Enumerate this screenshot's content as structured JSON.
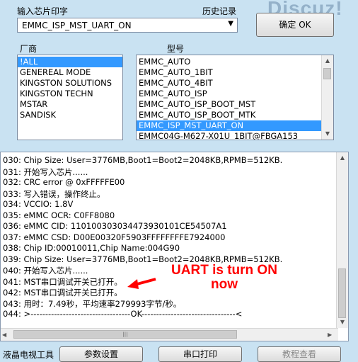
{
  "header": {
    "chip_label": "输入芯片印字",
    "history_label": "历史记录",
    "chip_value": "EMMC_ISP_MST_UART_ON",
    "confirm_button": "确定 OK"
  },
  "watermark": "Discuz!",
  "vendor": {
    "label": "厂商",
    "items": [
      "!ALL",
      "GENEREAL MODE",
      "KINGSTON SOLUTIONS",
      "KINGSTON TECHN",
      "MSTAR",
      "SANDISK"
    ],
    "selected_index": 0
  },
  "model": {
    "label": "型号",
    "items": [
      "EMMC_AUTO",
      "EMMC_AUTO_1BIT",
      "EMMC_AUTO_4BIT",
      "EMMC_AUTO_ISP",
      "EMMC_AUTO_ISP_BOOT_MST",
      "EMMC_AUTO_ISP_BOOT_MTK",
      "EMMC_ISP_MST_UART_ON",
      "EMMC04G-M627-X01U_1BIT@FBGA153"
    ],
    "selected_index": 6
  },
  "log": {
    "lines": [
      "030:  Chip Size: User=3776MB,Boot1=Boot2=2048KB,RPMB=512KB.",
      "031:  开始写入芯片......",
      "032:  CRC error @ 0xFFFFFE00",
      "033:  写入错误，操作终止。",
      "034:  VCCIO: 1.8V",
      "035:  eMMC OCR: C0FF8080",
      "036:  eMMC CID:  110100303034473930101CE54507A1",
      "037:  eMMC CSD: D00E00320F5903FFFFFFFFE7924000",
      "038:  Chip ID:00010011,Chip Name:004G90",
      "039:  Chip Size: User=3776MB,Boot1=Boot2=2048KB,RPMB=512KB.",
      "040:  开始写入芯片......",
      "041:  MST串口调试开关已打开。",
      "042:  MST串口调试开关已打开。",
      "043:  用时：7.49秒，平均速率279993字节/秒。",
      "044:  >----------------------------------OK--------------------------------<"
    ]
  },
  "annotation": {
    "line1": "UART is turn ON",
    "line2": "now"
  },
  "bottom": {
    "label": "液晶电视工具",
    "btn_params": "参数设置",
    "btn_serial": "串口打印",
    "btn_tutorial": "教程查看"
  }
}
